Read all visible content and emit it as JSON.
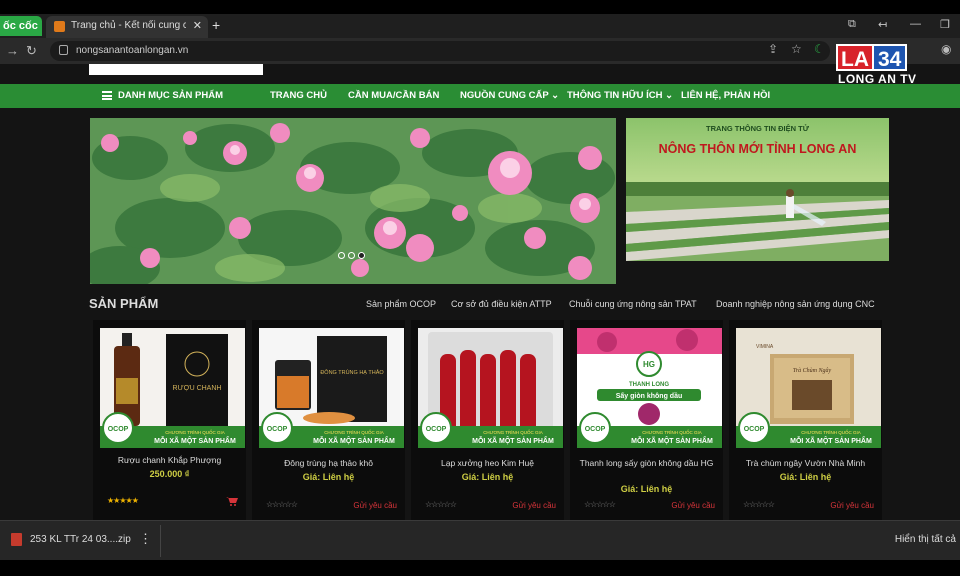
{
  "browser": {
    "brand": "ốc cốc",
    "tab_title": "Trang chủ - Kết nối cung cầu",
    "tab_close": "✕",
    "new_tab": "+",
    "url": "nongsanantoanlongan.vn"
  },
  "overlay_logo": {
    "la": "LA",
    "number": "34",
    "sub": "LONG AN TV"
  },
  "nav": {
    "categories": "DANH MỤC SẢN PHẨM",
    "items": [
      "TRANG CHỦ",
      "CẦN MUA/CẦN BÁN",
      "NGUỒN CUNG CẤP",
      "THÔNG TIN HỮU ÍCH",
      "LIÊN HỆ, PHẢN HỒI"
    ]
  },
  "side_ad": {
    "small": "TRANG THÔNG TIN ĐIỆN TỬ",
    "big": "NÔNG THÔN MỚI TỈNH LONG AN"
  },
  "products_section": {
    "title": "SẢN PHẨM",
    "categories": [
      "Sản phẩm OCOP",
      "Cơ sở đủ điều kiện ATTP",
      "Chuỗi cung ứng nông sản TPAT",
      "Doanh nghiệp nông sản ứng dụng CNC"
    ]
  },
  "product_image_text": {
    "ocop": "OCOP",
    "program": "CHƯƠNG TRÌNH QUỐC GIA",
    "program_main": "MỖI XÃ MỘT SẢN PHẨM",
    "brand_1": "RƯỢU CHANH",
    "brand_2": "ĐÔNG TRÙNG HẠ THẢO",
    "brand_4a": "HG",
    "brand_4b": "THANH LONG",
    "brand_4c": "Sấy giòn không dầu",
    "brand_5a": "VIMINA",
    "brand_5b": "Trà Chùm Ngây"
  },
  "products": [
    {
      "name": "Rượu chanh Khắp Phượng",
      "price": "250.000 ₫",
      "rating": 5
    },
    {
      "name": "Đông trùng hạ thảo khô",
      "price": "Giá: Liên hệ",
      "request": "Gửi yêu cầu",
      "rating": 0
    },
    {
      "name": "Lạp xưởng heo Kim Huệ",
      "price": "Giá: Liên hệ",
      "request": "Gửi yêu cầu",
      "rating": 0
    },
    {
      "name": "Thanh long sấy giòn không dầu HG",
      "price": "Giá: Liên hệ",
      "request": "Gửi yêu cầu",
      "rating": 0
    },
    {
      "name": "Trà chùm ngây Vườn Nhà Minh",
      "price": "Giá: Liên hệ",
      "request": "Gửi yêu cầu",
      "rating": 0
    }
  ],
  "stars": {
    "filled": "★★★★★",
    "empty": "☆☆☆☆☆"
  },
  "download": {
    "file": "253 KL TTr 24 03....zip",
    "show_all": "Hiển thị tất cả",
    "more": "⋮"
  },
  "colors": {
    "nav_green": "#2a8d34",
    "price_yellow": "#cfcf44",
    "request_red": "#d6343a"
  }
}
